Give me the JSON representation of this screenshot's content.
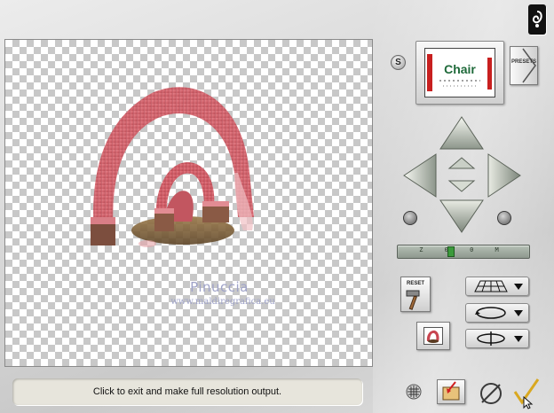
{
  "preview": {
    "watermark_name": "Pinuccia",
    "watermark_url": "www.maldiregrafica.eu"
  },
  "status_bar": {
    "text": "Click to exit and make full resolution output."
  },
  "presets": {
    "s_label": "S",
    "thumbnail_text": "Chair",
    "button_label": "PRESETS"
  },
  "controls": {
    "reset_label": "RESET",
    "zoom_ticks": "Z 0 0 M"
  },
  "icons": {
    "top_right": "info-icon",
    "nav": [
      "arrow-up-icon",
      "arrow-left-icon",
      "arrow-right-icon",
      "arrow-down-icon",
      "small-up-icon",
      "small-down-icon"
    ],
    "bottom": [
      "grid-icon",
      "open-folder-icon",
      "cancel-icon",
      "ok-check-icon"
    ]
  },
  "colors": {
    "object": "#d96b73",
    "checker_dark": "#c8c8c8",
    "status_bg": "#e7e5dc"
  }
}
